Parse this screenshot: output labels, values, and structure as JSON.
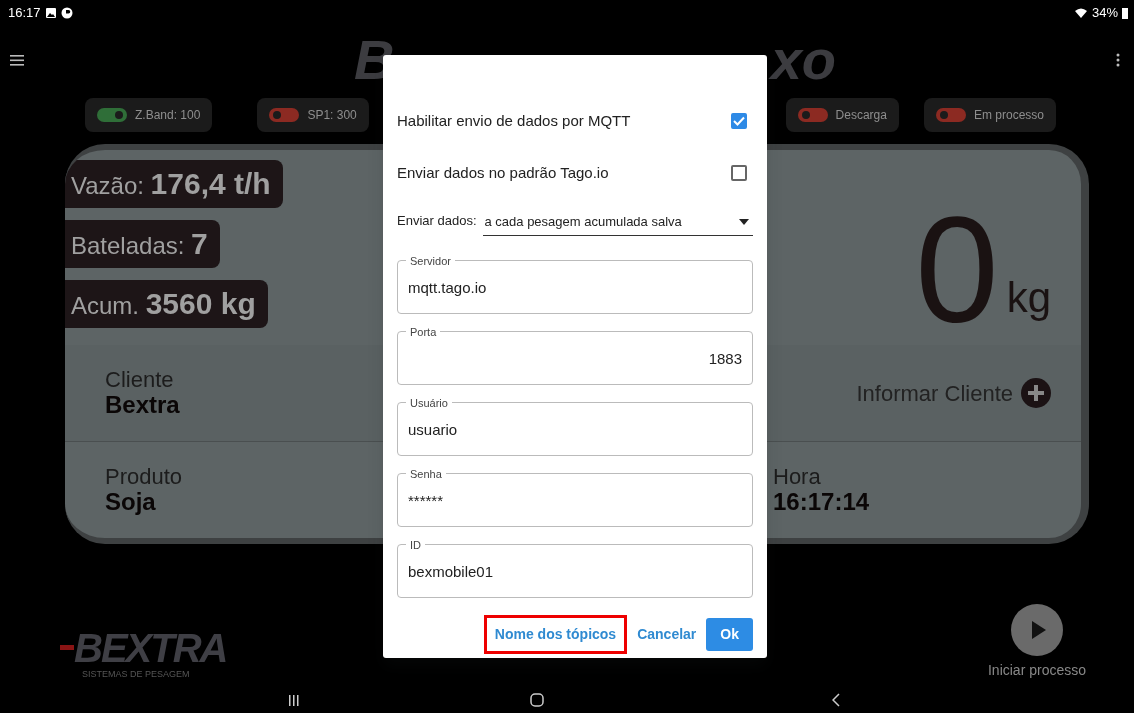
{
  "status_bar": {
    "time": "16:17",
    "battery": "34%"
  },
  "app_bar": {
    "title_fragments": [
      "B",
      "xo"
    ]
  },
  "indicators": [
    {
      "label": "Z.Band: 100",
      "on": true
    },
    {
      "label": "SP1: 300",
      "on": false
    },
    {
      "label": "Descarga",
      "on": false
    },
    {
      "label": "Em processo",
      "on": false
    }
  ],
  "panel": {
    "readings": [
      {
        "label": "Vazão:",
        "value": "176,4 t/h"
      },
      {
        "label": "Bateladas:",
        "value": "7"
      },
      {
        "label": "Acum.",
        "value": "3560 kg"
      }
    ],
    "weight": {
      "value": "0",
      "unit": "kg"
    },
    "client": {
      "label": "Cliente",
      "value": "Bextra"
    },
    "add_client": "Informar Cliente",
    "product": {
      "label": "Produto",
      "value": "Soja"
    },
    "time": {
      "label": "Hora",
      "value": "16:17:14"
    }
  },
  "footer": {
    "logo": "BEXTRA",
    "tagline": "SISTEMAS DE PESAGEM",
    "action": "Iniciar processo"
  },
  "dialog": {
    "options": [
      {
        "label": "Habilitar envio de dados por MQTT",
        "checked": true
      },
      {
        "label": "Enviar dados no padrão Tago.io",
        "checked": false
      }
    ],
    "send": {
      "label": "Enviar dados:",
      "value": "a cada pesagem acumulada salva"
    },
    "fields": [
      {
        "label": "Servidor",
        "value": "mqtt.tago.io",
        "kind": "text"
      },
      {
        "label": "Porta",
        "value": "1883",
        "kind": "number"
      },
      {
        "label": "Usuário",
        "value": "usuario",
        "kind": "text"
      },
      {
        "label": "Senha",
        "value": "******",
        "kind": "text"
      },
      {
        "label": "ID",
        "value": "bexmobile01",
        "kind": "text"
      }
    ],
    "buttons": [
      {
        "label": "Nome dos tópicos",
        "kind": "text",
        "highlighted": true
      },
      {
        "label": "Cancelar",
        "kind": "text",
        "highlighted": false
      },
      {
        "label": "Ok",
        "kind": "primary",
        "highlighted": false
      }
    ]
  }
}
